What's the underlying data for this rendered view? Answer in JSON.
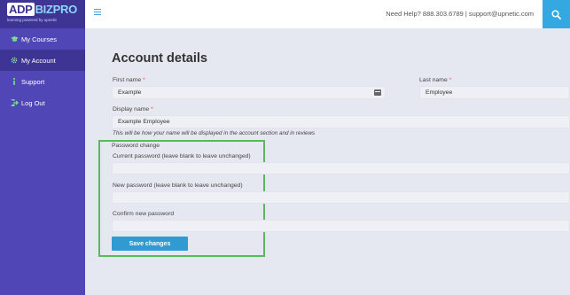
{
  "brand": {
    "adp": "ADP",
    "name": "BIZPRO",
    "tagline": "learning powered by upnetic"
  },
  "sidebar": {
    "items": [
      {
        "label": "My Courses",
        "icon": "graduation-cap-icon",
        "active": false
      },
      {
        "label": "My Account",
        "icon": "gear-icon",
        "active": true
      },
      {
        "label": "Support",
        "icon": "info-icon",
        "active": false
      },
      {
        "label": "Log Out",
        "icon": "logout-icon",
        "active": false
      }
    ]
  },
  "header": {
    "help_text": "Need Help? 888.303.6789 | support@upnetic.com",
    "menu_icon": "hamburger-icon",
    "search_icon": "search-icon",
    "accent_color": "#34a9e1"
  },
  "main": {
    "title": "Account details",
    "first_name": {
      "label": "First name",
      "required_mark": "*",
      "value": "Example"
    },
    "last_name": {
      "label": "Last name",
      "required_mark": "*",
      "value": "Employee"
    },
    "display_name": {
      "label": "Display name",
      "required_mark": "*",
      "value": "Example Employee",
      "note": "This will be how your name will be displayed in the account section and in reviews"
    },
    "password_section": {
      "legend": "Password change",
      "current_label": "Current password (leave blank to leave unchanged)",
      "new_label": "New password (leave blank to leave unchanged)",
      "confirm_label": "Confirm new password"
    },
    "save_label": "Save changes"
  }
}
